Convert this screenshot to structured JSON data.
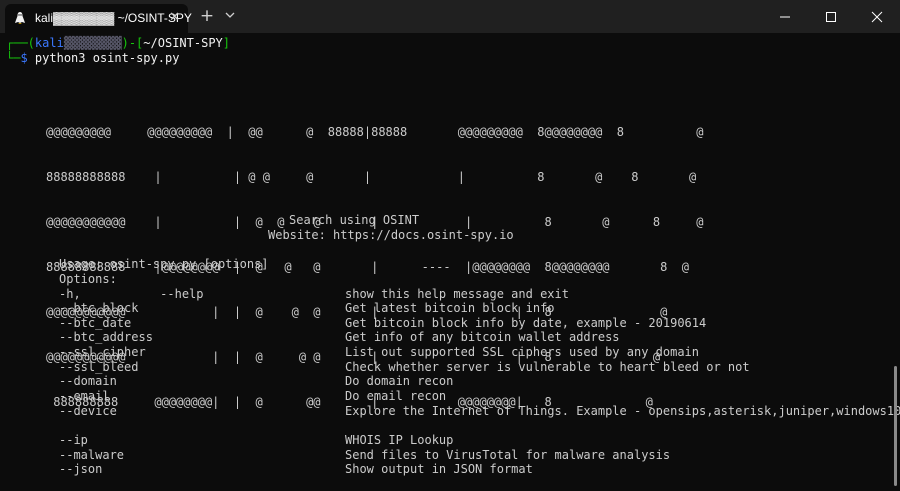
{
  "tab": {
    "title": "kali▓▓▓▓▓▓▓ ~/OSINT-SPY",
    "close": "✕"
  },
  "newtab": "+",
  "prompt": {
    "user": "kali",
    "hidden": "▓▓▓▓▓▓▓▓",
    "path": "~/OSINT-SPY",
    "symbol": "$",
    "command": "python3 osint-spy.py"
  },
  "art_lines": [
    "@@@@@@@@@     @@@@@@@@@  |  @@      @  88888|88888       @@@@@@@@@  8@@@@@@@@  8          @",
    "88888888888    |          | @ @     @       |            |          8       @    8       @",
    "@@@@@@@@@@@    |          |  @  @    @       |            |          8       @      8     @",
    "88888888888    |@@@@@@@@  |  @   @   @       |      ----  |@@@@@@@@  8@@@@@@@@       8  @",
    "@@@@@@@@@@@            |  |  @    @  @       |                   |   8               @",
    "@@@@@@@@@@@            |  |  @     @ @       |                   |   8              @",
    " 888888888     @@@@@@@@|  |  @      @@       |           @@@@@@@@|   8             @"
  ],
  "banner": {
    "search": "Search using OSINT",
    "website": "Website: https://docs.osint-spy.io"
  },
  "usage": "Usage: osint-spy.py [options]",
  "options_label": "Options:",
  "options": [
    {
      "flag": "-h,           --help",
      "desc": "show this help message and exit"
    },
    {
      "flag": "--btc_block",
      "desc": "Get latest bitcoin block info"
    },
    {
      "flag": "--btc_date",
      "desc": "Get bitcoin block info by date, example - 20190614"
    },
    {
      "flag": "--btc_address",
      "desc": "Get info of any bitcoin wallet address"
    },
    {
      "flag": "--ssl_cipher",
      "desc": "List out supported SSL ciphers used by any domain"
    },
    {
      "flag": "--ssl_bleed",
      "desc": "Check whether server is vulnerable to heart bleed or not"
    },
    {
      "flag": "--domain",
      "desc": "Do domain recon"
    },
    {
      "flag": "--email",
      "desc": "Do email recon"
    },
    {
      "flag": "--device",
      "desc": "Explore the Internet of Things. Example - opensips,asterisk,juniper,windows10"
    },
    {
      "flag": "",
      "desc": ""
    },
    {
      "flag": "--ip",
      "desc": "WHOIS IP Lookup"
    },
    {
      "flag": "--malware",
      "desc": "Send files to VirusTotal for malware analysis"
    },
    {
      "flag": "--json",
      "desc": "Show output in JSON format"
    }
  ]
}
